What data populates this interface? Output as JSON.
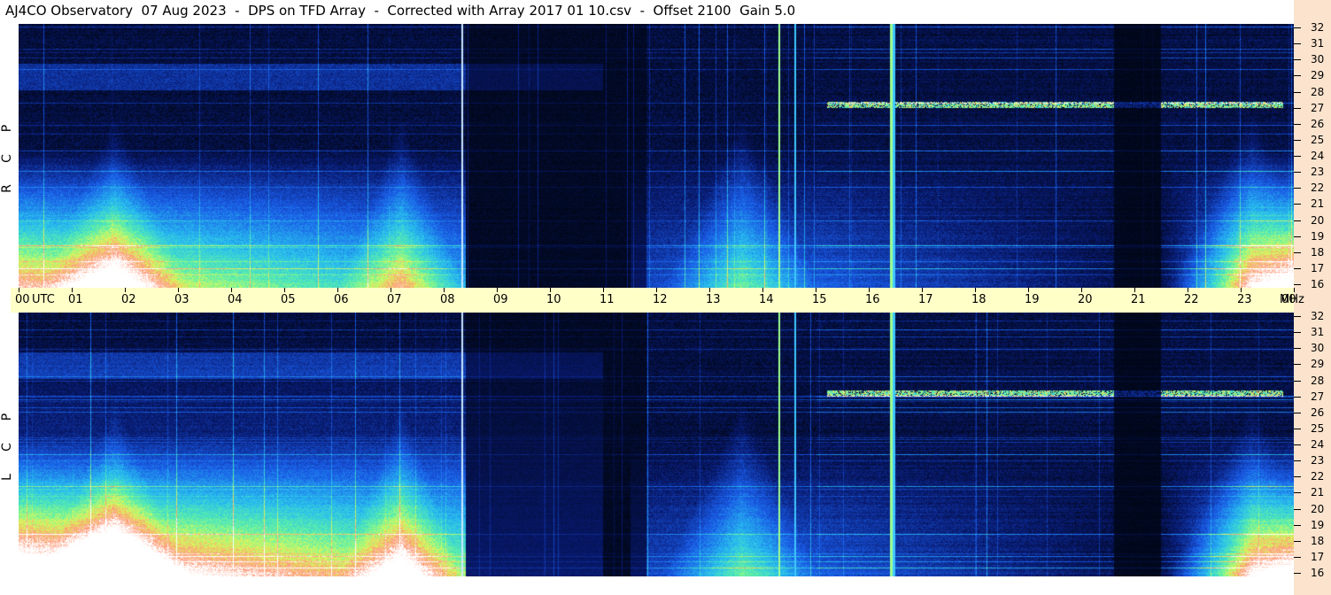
{
  "title": "AJ4CO Observatory  07 Aug 2023  -  DPS on TFD Array  -  Corrected with Array 2017 01 10.csv  -  Offset 2100  Gain 5.0",
  "chart_data": {
    "type": "heatmap",
    "panels": [
      {
        "name": "RCP",
        "label_letters": [
          "P",
          "C",
          "R"
        ]
      },
      {
        "name": "LCP",
        "label_letters": [
          "P",
          "C",
          "L"
        ]
      }
    ],
    "x_axis": {
      "unit": "UTC",
      "ticks": [
        "00",
        "01",
        "02",
        "03",
        "04",
        "05",
        "06",
        "07",
        "08",
        "09",
        "10",
        "11",
        "12",
        "13",
        "14",
        "15",
        "16",
        "17",
        "18",
        "19",
        "20",
        "21",
        "22",
        "23",
        "00"
      ],
      "range": [
        0,
        24
      ]
    },
    "y_axis": {
      "unit": "MHz",
      "ticks": [
        "16",
        "17",
        "18",
        "19",
        "20",
        "21",
        "22",
        "23",
        "24",
        "25",
        "26",
        "27",
        "28",
        "29",
        "30",
        "31",
        "32"
      ],
      "range": [
        16,
        32
      ]
    },
    "features": {
      "vertical_lines_utc": [
        8.33,
        14.3,
        14.6,
        16.4,
        16.45
      ],
      "bright_band_mhz": 27.2,
      "bright_band_utc_range": [
        15.2,
        23.8
      ],
      "dark_gap_utc": [
        20.6,
        21.5
      ]
    },
    "colors": {
      "background": "#000510",
      "axis_bg": "#ffffc8",
      "right_bar_bg": "#fbe3cd"
    }
  }
}
